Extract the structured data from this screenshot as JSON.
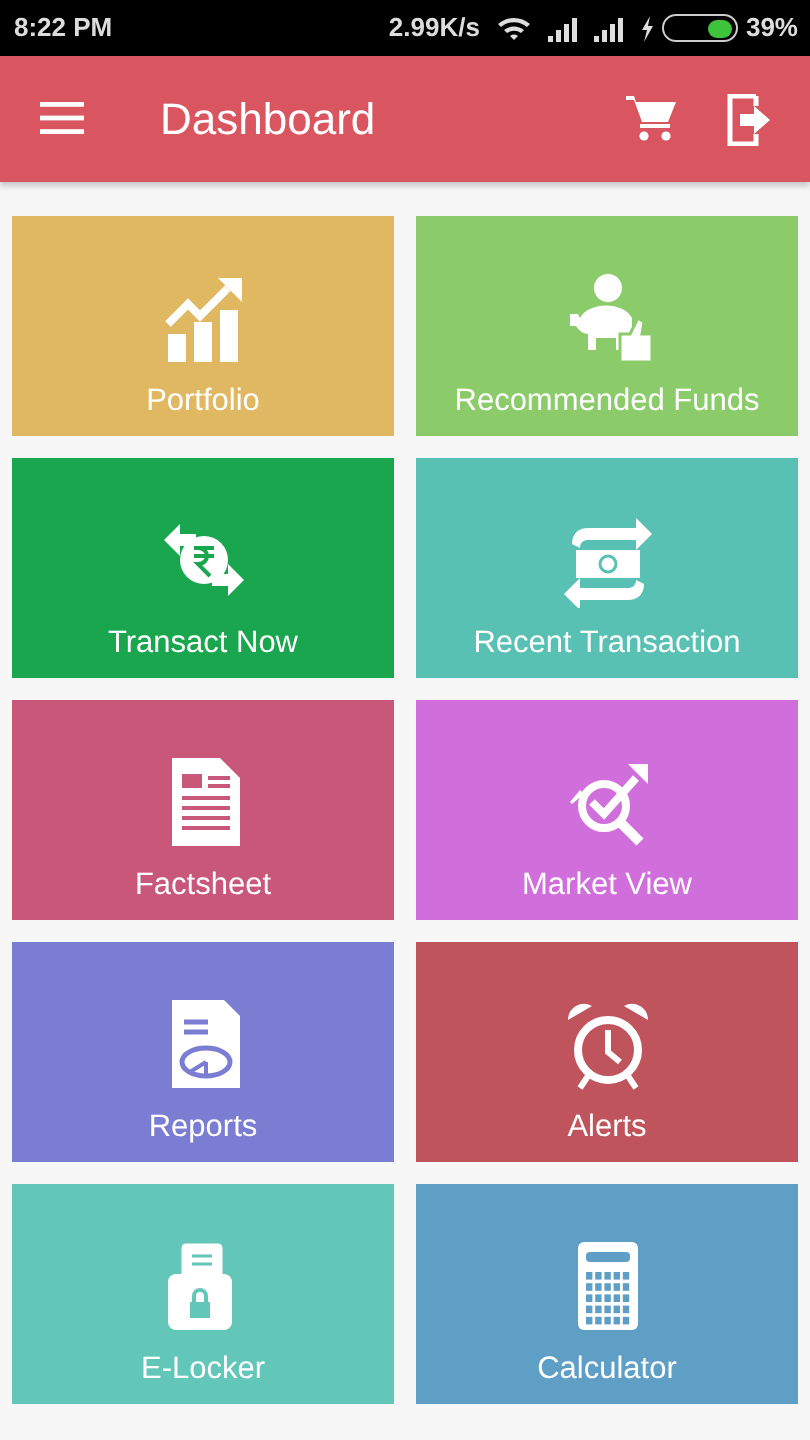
{
  "status_bar": {
    "time": "8:22 PM",
    "speed": "2.99K/s",
    "battery": {
      "level": 0.39,
      "reading": "39%"
    }
  },
  "app_bar": {
    "title": "Dashboard"
  },
  "tiles": [
    {
      "label": "Portfolio",
      "color": "#e0b862"
    },
    {
      "label": "Recommended Funds",
      "color": "#8ccb6a"
    },
    {
      "label": "Transact Now",
      "color": "#19a64f"
    },
    {
      "label": "Recent Transaction",
      "color": "#58c1b3"
    },
    {
      "label": "Factsheet",
      "color": "#c9577a"
    },
    {
      "label": "Market View",
      "color": "#d06edb"
    },
    {
      "label": "Reports",
      "color": "#7a7dd1"
    },
    {
      "label": "Alerts",
      "color": "#c0545d"
    },
    {
      "label": "E-Locker",
      "color": "#62c6b8"
    },
    {
      "label": "Calculator",
      "color": "#5f9fc5"
    }
  ]
}
